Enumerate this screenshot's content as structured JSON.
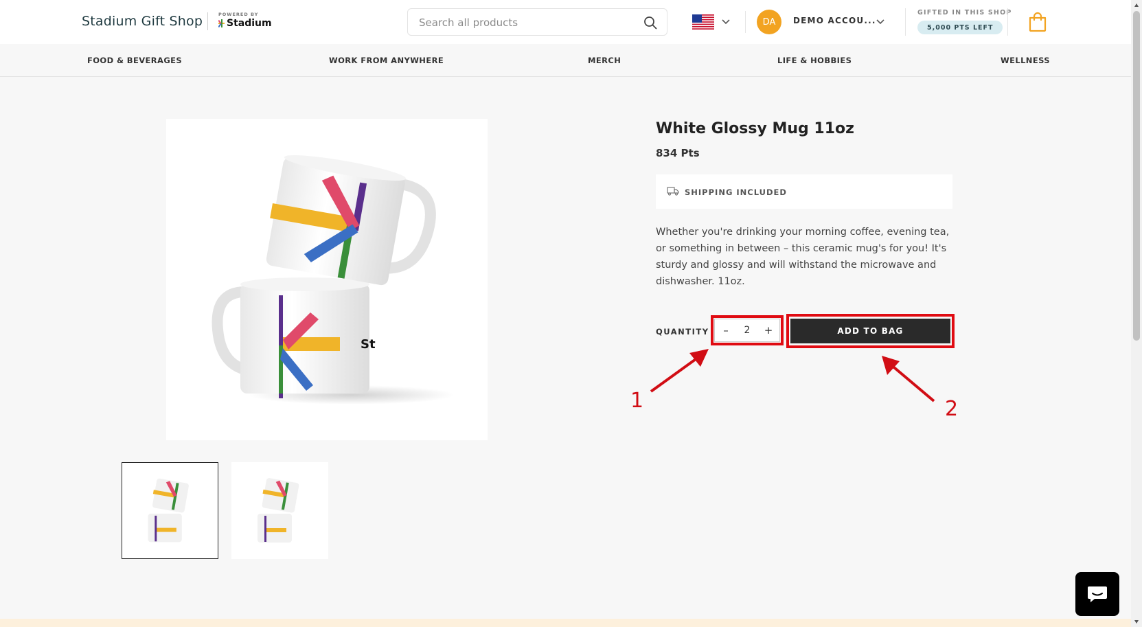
{
  "header": {
    "shop_name": "Stadium Gift Shop",
    "powered_by": "POWERED BY",
    "brand": "Stadium",
    "search_placeholder": "Search all products",
    "account_initials": "DA",
    "account_name": "DEMO ACCOU...",
    "gifted_label": "GIFTED IN THIS SHOP",
    "points_left": "5,000 PTS LEFT",
    "accent_color": "#f2a321"
  },
  "nav": {
    "items": [
      {
        "label": "FOOD & BEVERAGES"
      },
      {
        "label": "WORK FROM ANYWHERE"
      },
      {
        "label": "MERCH"
      },
      {
        "label": "LIFE & HOBBIES"
      },
      {
        "label": "WELLNESS"
      }
    ]
  },
  "product": {
    "title": "White Glossy Mug 11oz",
    "price": "834 Pts",
    "shipping": "SHIPPING INCLUDED",
    "description": "Whether you're drinking your morning coffee, evening tea, or something in between – this ceramic mug's for you! It's sturdy and glossy and will withstand the microwave and dishwasher. 11oz.",
    "quantity_label": "QUANTITY",
    "quantity_value": "2",
    "minus": "–",
    "plus": "+",
    "add_to_bag": "ADD TO BAG"
  },
  "annotations": {
    "one": "1",
    "two": "2",
    "color": "#e00b12"
  },
  "icons": {
    "search": "search-icon",
    "flag": "us-flag-icon",
    "bag": "shopping-bag-icon",
    "truck": "truck-icon",
    "chat": "chat-icon"
  }
}
